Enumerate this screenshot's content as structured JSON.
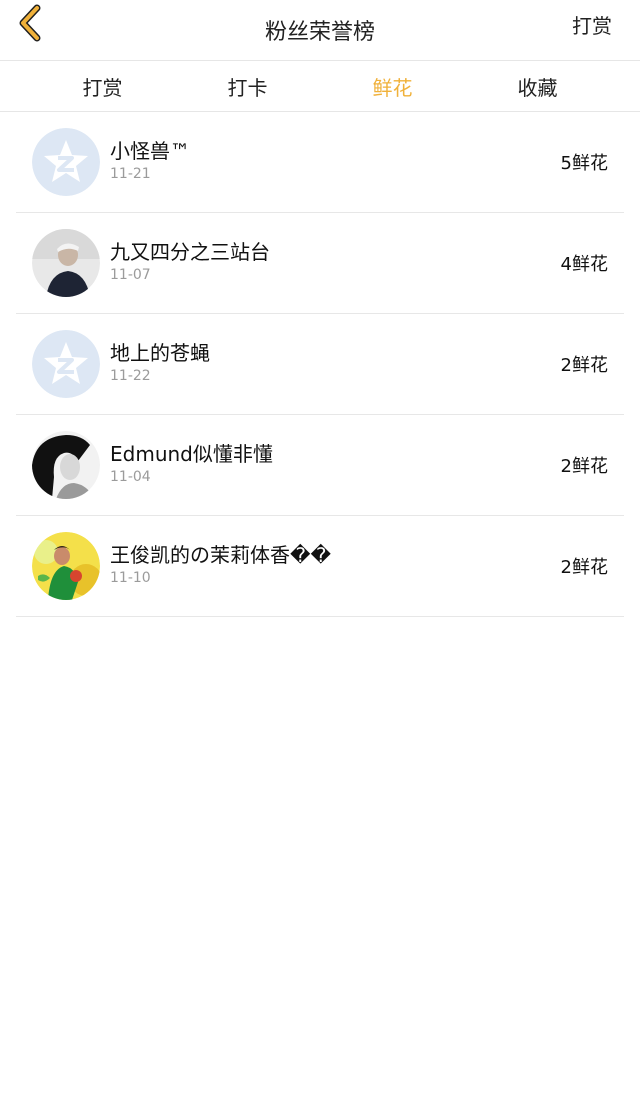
{
  "header": {
    "title": "粉丝荣誉榜",
    "right_action": "打赏"
  },
  "tabs": [
    {
      "label": "打赏"
    },
    {
      "label": "打卡"
    },
    {
      "label": "鲜花"
    },
    {
      "label": "收藏"
    }
  ],
  "active_tab": "鲜花",
  "list": [
    {
      "name": "小怪兽™",
      "date": "11-21",
      "count": "5鲜花",
      "avatar": "qq-default-avatar"
    },
    {
      "name": "九又四分之三站台",
      "date": "11-07",
      "count": "4鲜花",
      "avatar": "photo-avatar"
    },
    {
      "name": "地上的苍蝇",
      "date": "11-22",
      "count": "2鲜花",
      "avatar": "qq-default-avatar"
    },
    {
      "name": "Edmund似懂非懂",
      "date": "11-04",
      "count": "2鲜花",
      "avatar": "photo-avatar"
    },
    {
      "name": "王俊凯的の茉莉体香��",
      "date": "11-10",
      "count": "2鲜花",
      "avatar": "photo-avatar"
    }
  ],
  "colors": {
    "active_tab": "#f0b13a",
    "back_icon": "#f0b13a",
    "divider": "#e7e7e7",
    "date_text": "#9b9b9b"
  }
}
